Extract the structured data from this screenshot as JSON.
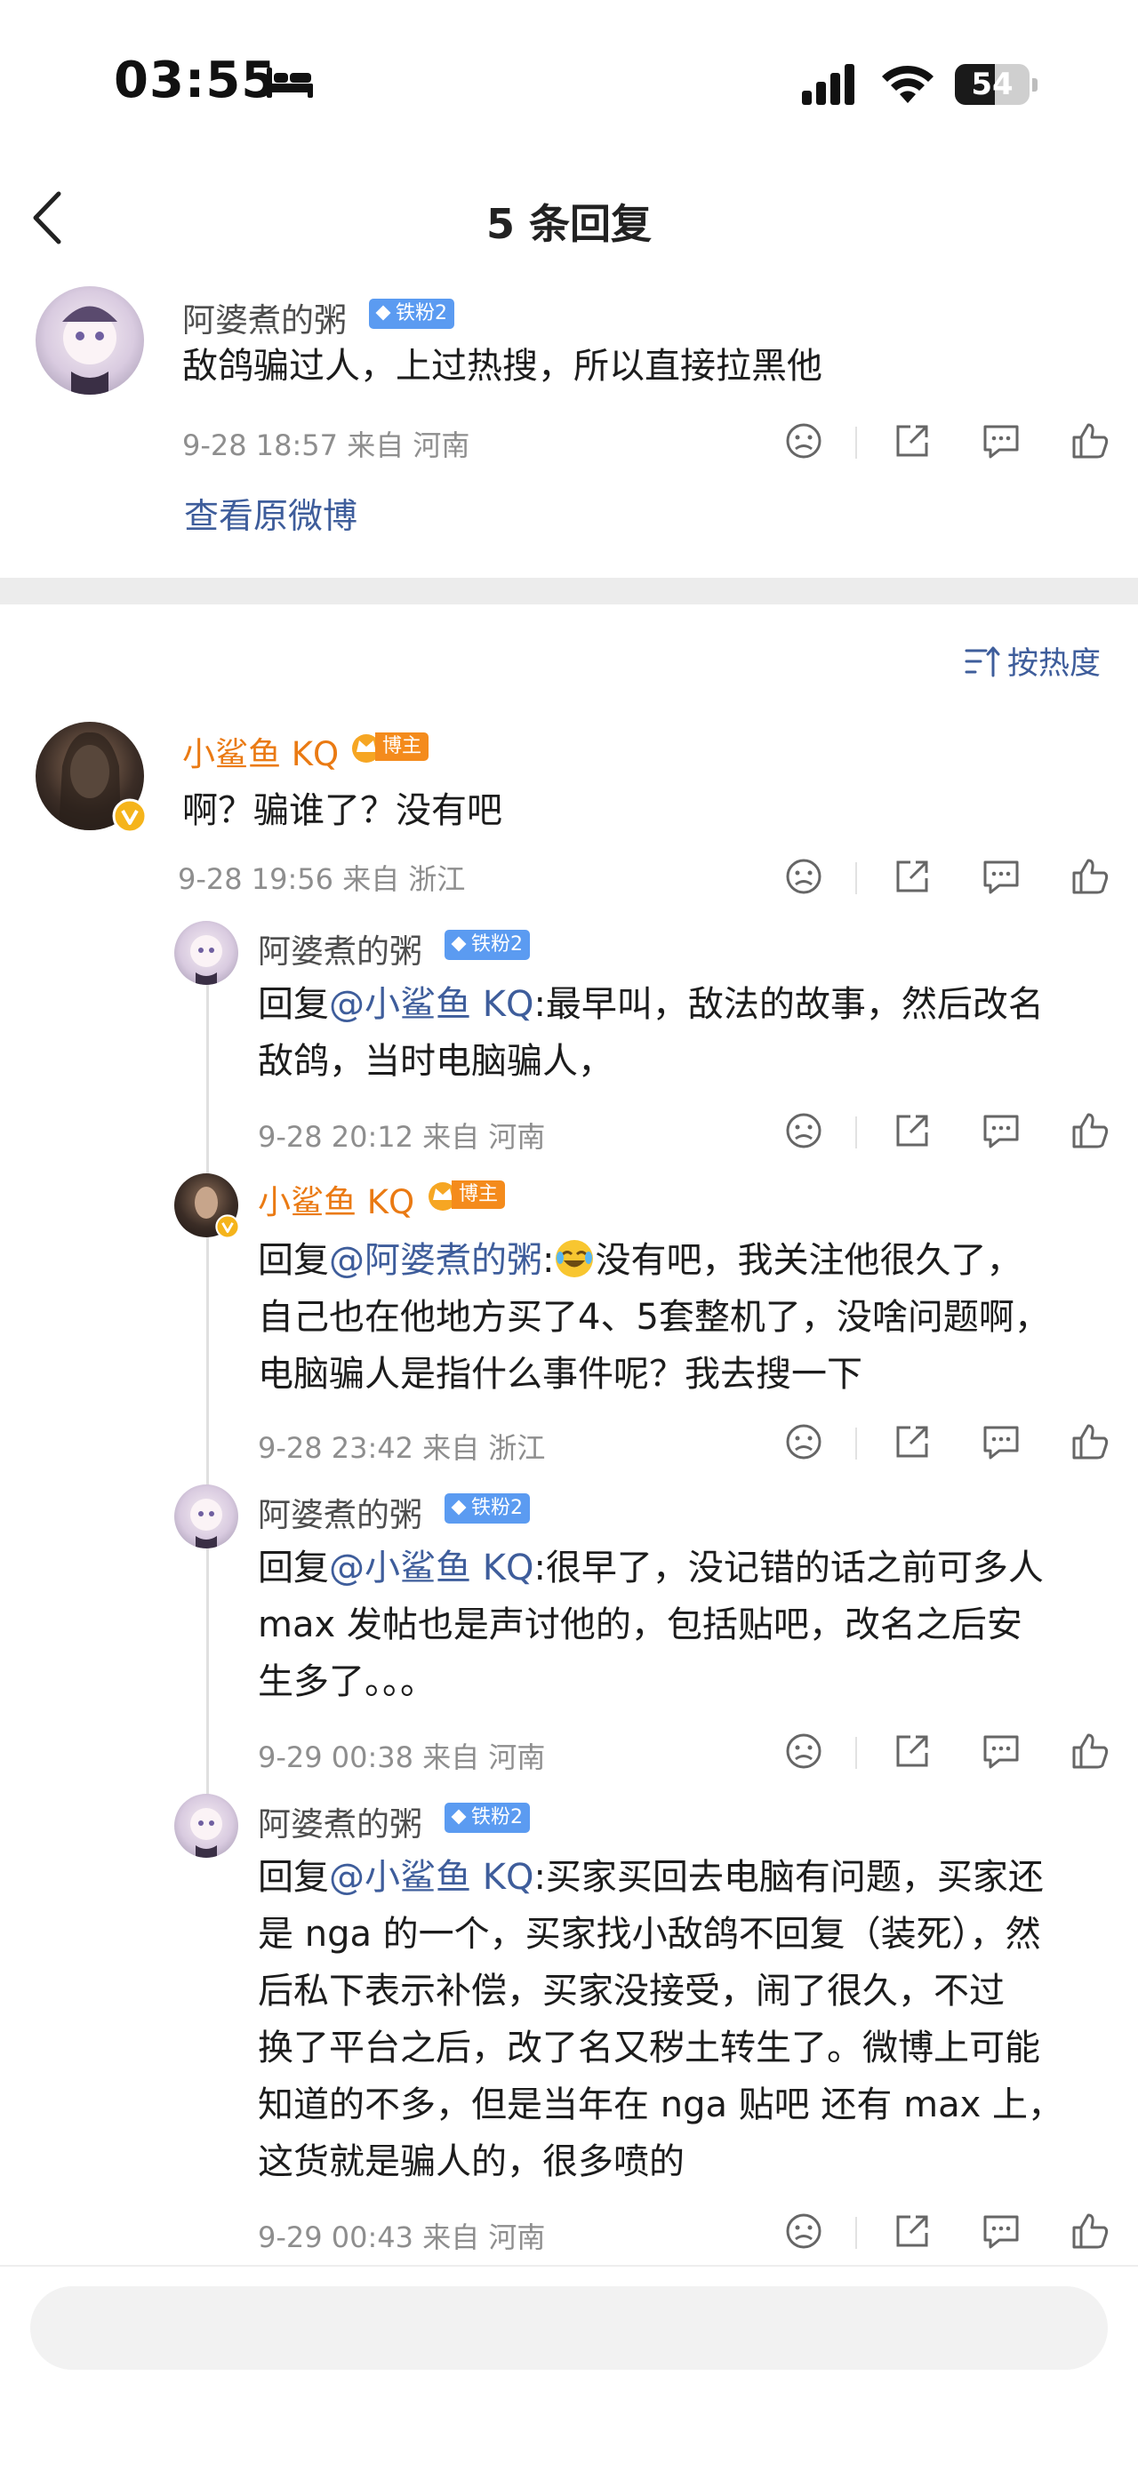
{
  "status": {
    "time": "03:55",
    "battery": "54",
    "battery_level": 0.54
  },
  "header": {
    "title": "5 条回复"
  },
  "original": {
    "author": "阿婆煮的粥",
    "badge": "铁粉2",
    "text": "敌鸽骗过人，上过热搜，所以直接拉黑他",
    "meta": "9-28 18:57  来自 河南",
    "view_original": "查看原微博"
  },
  "sort": {
    "label": "按热度"
  },
  "main_reply": {
    "author": "小鲨鱼 KQ",
    "badge": "博主",
    "text": "啊？骗谁了？没有吧",
    "meta": "9-28 19:56  来自 浙江"
  },
  "replies": [
    {
      "author": "阿婆煮的粥",
      "badge": "铁粉2",
      "prefix": "回复",
      "mention": "@小鲨鱼 KQ",
      "lines": [
        "回复@小鲨鱼 KQ:最早叫，敌法的故事，然后改名",
        "敌鸽，当时电脑骗人，"
      ],
      "line1_rest": ":最早叫，敌法的故事，然后改名",
      "line2": "敌鸽，当时电脑骗人，",
      "meta": "9-28 20:12  来自 河南"
    },
    {
      "author": "小鲨鱼 KQ",
      "badge": "博主",
      "prefix": "回复",
      "mention": "@阿婆煮的粥",
      "line1_rest": ":",
      "line1_after_emoji": "没有吧，我关注他很久了，",
      "line2": "自己也在他地方买了4、5套整机了，没啥问题啊，",
      "line3": "电脑骗人是指什么事件呢？我去搜一下",
      "meta": "9-28 23:42  来自 浙江"
    },
    {
      "author": "阿婆煮的粥",
      "badge": "铁粉2",
      "prefix": "回复",
      "mention": "@小鲨鱼 KQ",
      "line1_rest": ":很早了，没记错的话之前可多人",
      "line2": "max 发帖也是声讨他的，包括贴吧，改名之后安",
      "line3": "生多了。。。",
      "meta": "9-29 00:38  来自 河南"
    },
    {
      "author": "阿婆煮的粥",
      "badge": "铁粉2",
      "prefix": "回复",
      "mention": "@小鲨鱼 KQ",
      "line1_rest": ":买家买回去电脑有问题，买家还",
      "line2": "是 nga 的一个，买家找小敌鸽不回复（装死），然",
      "line3": "后私下表示补偿，买家没接受，闹了很久，不过",
      "line4": "换了平台之后，改了名又秽土转生了。微博上可能",
      "line5": "知道的不多，但是当年在 nga 贴吧 还有 max 上，",
      "line6": "这货就是骗人的，很多喷的",
      "meta": "9-29 00:43  来自 河南"
    }
  ],
  "colors": {
    "link": "#3e5d9b",
    "author_host": "#ea7a13",
    "badge_fan": "#5b9bf1",
    "badge_host": "#f48b1c"
  }
}
